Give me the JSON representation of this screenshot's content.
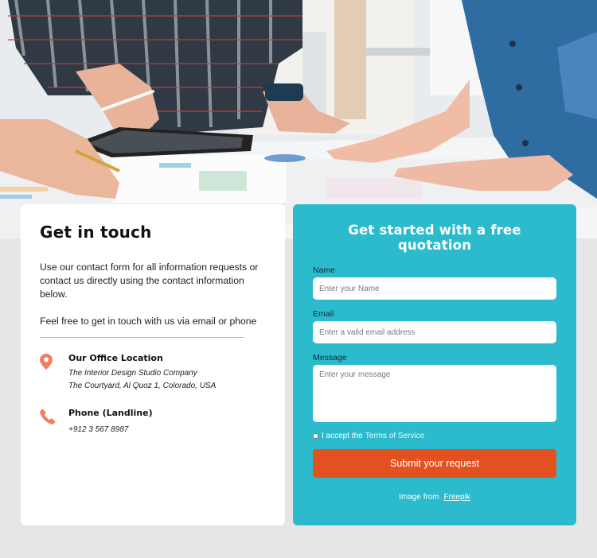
{
  "contact": {
    "heading": "Get in touch",
    "intro": "Use our contact form for all information requests or contact us directly using the contact information below.",
    "intro2": "Feel free to get in touch with us via email or phone",
    "office": {
      "title": "Our Office Location",
      "line1": "The Interior Design Studio Company",
      "line2": "The Courtyard, Al Quoz 1, Colorado,  USA",
      "icon": "map-pin-icon"
    },
    "phone": {
      "title": "Phone (Landline)",
      "number": "+912 3 567 8987",
      "icon": "phone-icon"
    }
  },
  "form": {
    "heading": "Get started with a free quotation",
    "name_label": "Name",
    "name_placeholder": "Enter your Name",
    "email_label": "Email",
    "email_placeholder": "Enter a valid email address",
    "message_label": "Message",
    "message_placeholder": "Enter your message",
    "terms_prefix": "I accept the",
    "terms_link": "Terms of Service",
    "submit_label": "Submit your request",
    "credit_prefix": "Image from",
    "credit_link": "Freepik"
  },
  "colors": {
    "accent": "#2bbbcd",
    "button": "#e35120",
    "icon": "#f07f5f"
  }
}
